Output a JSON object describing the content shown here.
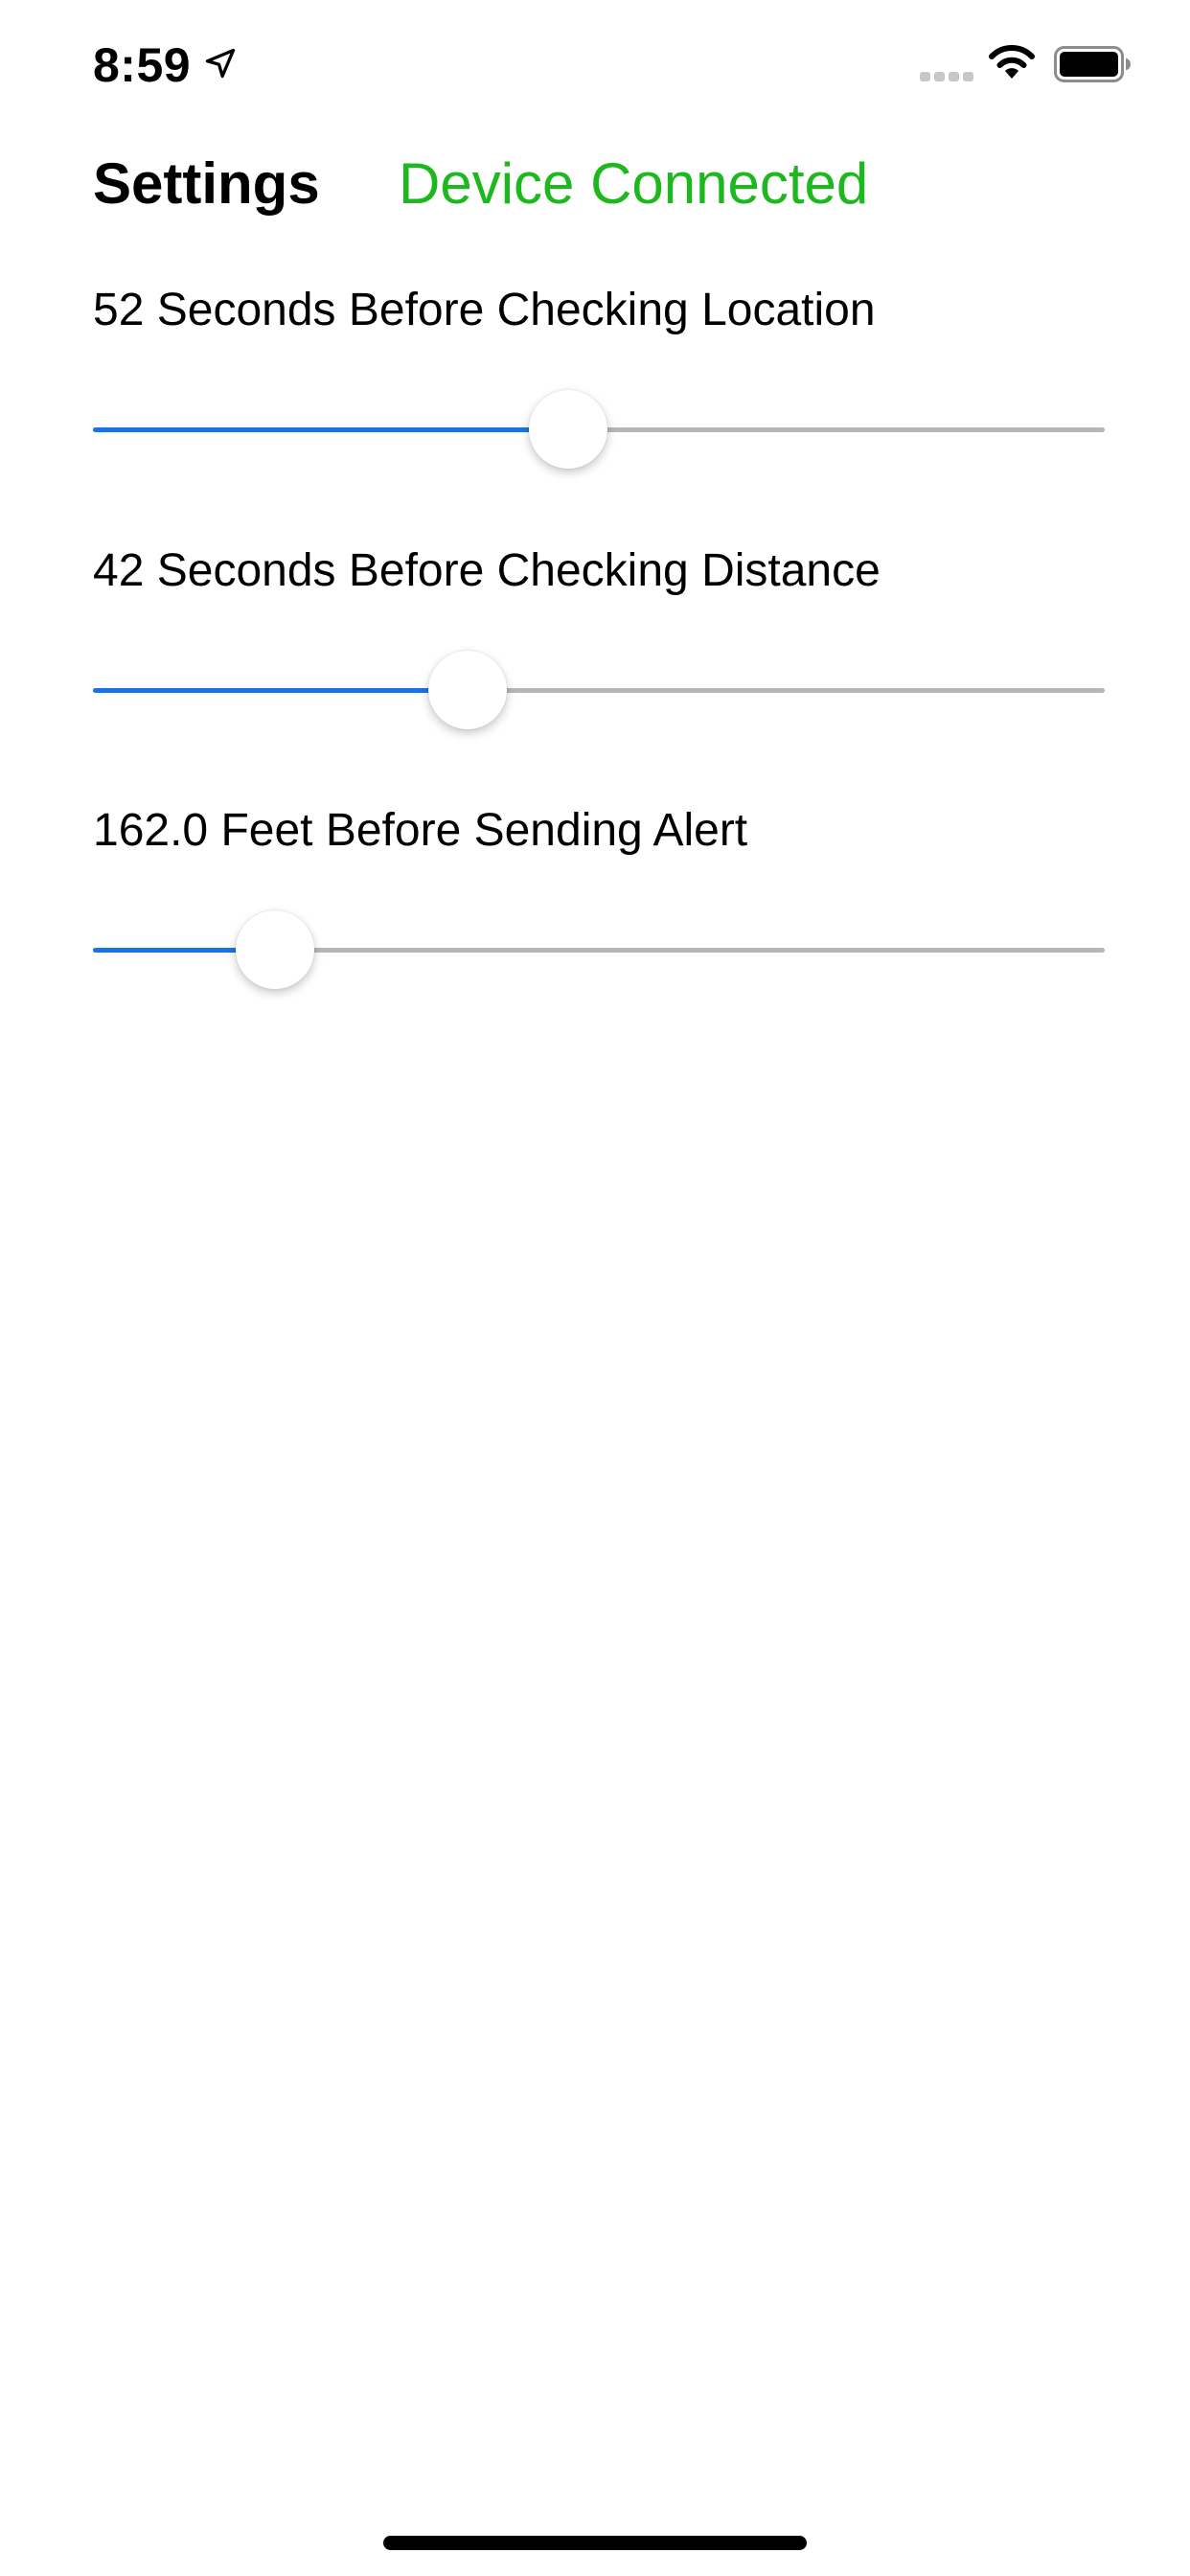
{
  "status_bar": {
    "time": "8:59",
    "icons": [
      "location-arrow-icon",
      "cellular-signal-icon",
      "wifi-icon",
      "battery-icon"
    ]
  },
  "header": {
    "title": "Settings",
    "connection_status": "Device Connected"
  },
  "settings": [
    {
      "label": "52 Seconds Before Checking Location",
      "level": 0.47
    },
    {
      "label": "42 Seconds Before Checking Distance",
      "level": 0.37
    },
    {
      "label": "162.0 Feet Before Sending Alert",
      "level": 0.18
    }
  ],
  "colors": {
    "accent": "#1a73e8",
    "connected": "#1db81d",
    "track": "#b6b6b6",
    "text": "#000000",
    "background": "#ffffff"
  }
}
